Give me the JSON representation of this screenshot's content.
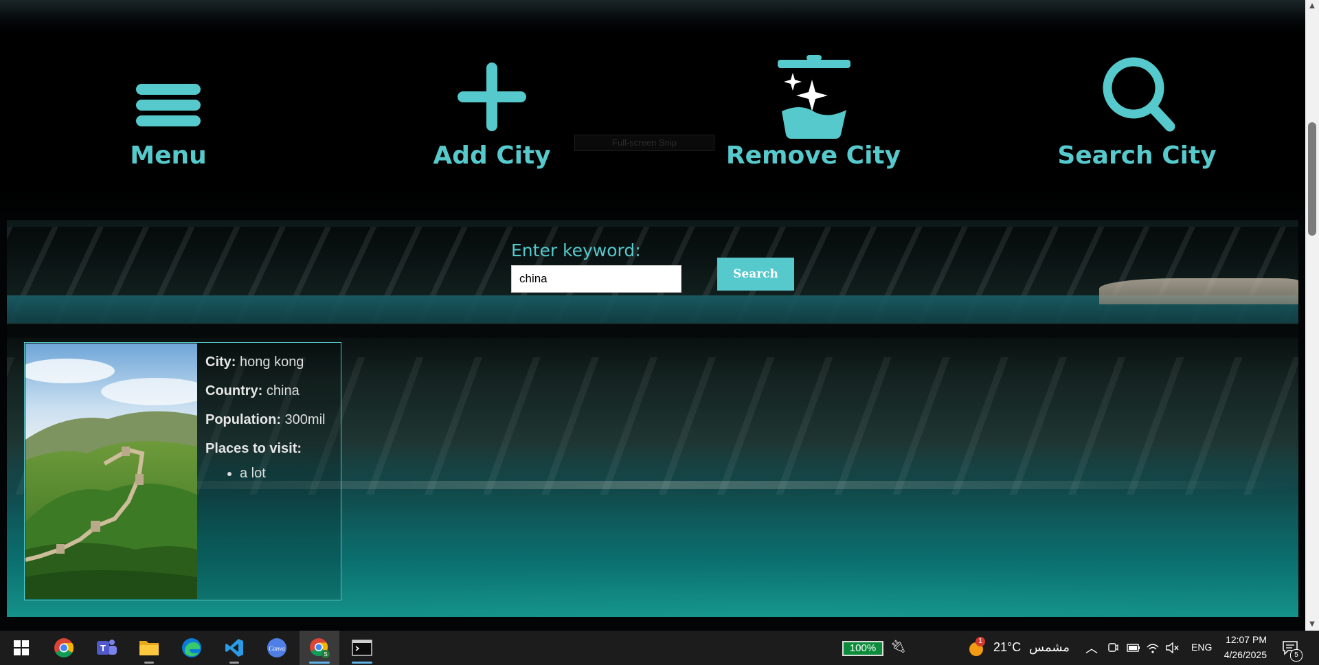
{
  "nav": {
    "items": [
      {
        "label": "Menu",
        "icon": "hamburger-menu-icon"
      },
      {
        "label": "Add City",
        "icon": "plus-icon"
      },
      {
        "label": "Remove City",
        "icon": "trash-sparkle-icon"
      },
      {
        "label": "Search City",
        "icon": "magnifier-icon"
      }
    ],
    "accent": "#56c9cc"
  },
  "snip_tooltip": "Full-screen Snip",
  "search": {
    "label": "Enter keyword:",
    "value": "china",
    "button": "Search"
  },
  "result_card": {
    "city_label": "City:",
    "city": "hong kong",
    "country_label": "Country:",
    "country": "china",
    "population_label": "Population:",
    "population": "300mil",
    "places_label": "Places to visit:",
    "places": [
      "a lot"
    ],
    "image": "great-wall-photo"
  },
  "taskbar": {
    "apps": [
      "windows-start-icon",
      "chrome-icon",
      "teams-icon",
      "file-explorer-icon",
      "edge-icon",
      "vscode-icon",
      "canva-icon",
      "chrome-profile-icon",
      "terminal-icon"
    ],
    "battery": "100%",
    "weather_badge": "1",
    "temperature": "21°C",
    "weather_text": "مشمس",
    "language": "ENG",
    "time": "12:07 PM",
    "date": "4/26/2025",
    "notifications": "5"
  }
}
